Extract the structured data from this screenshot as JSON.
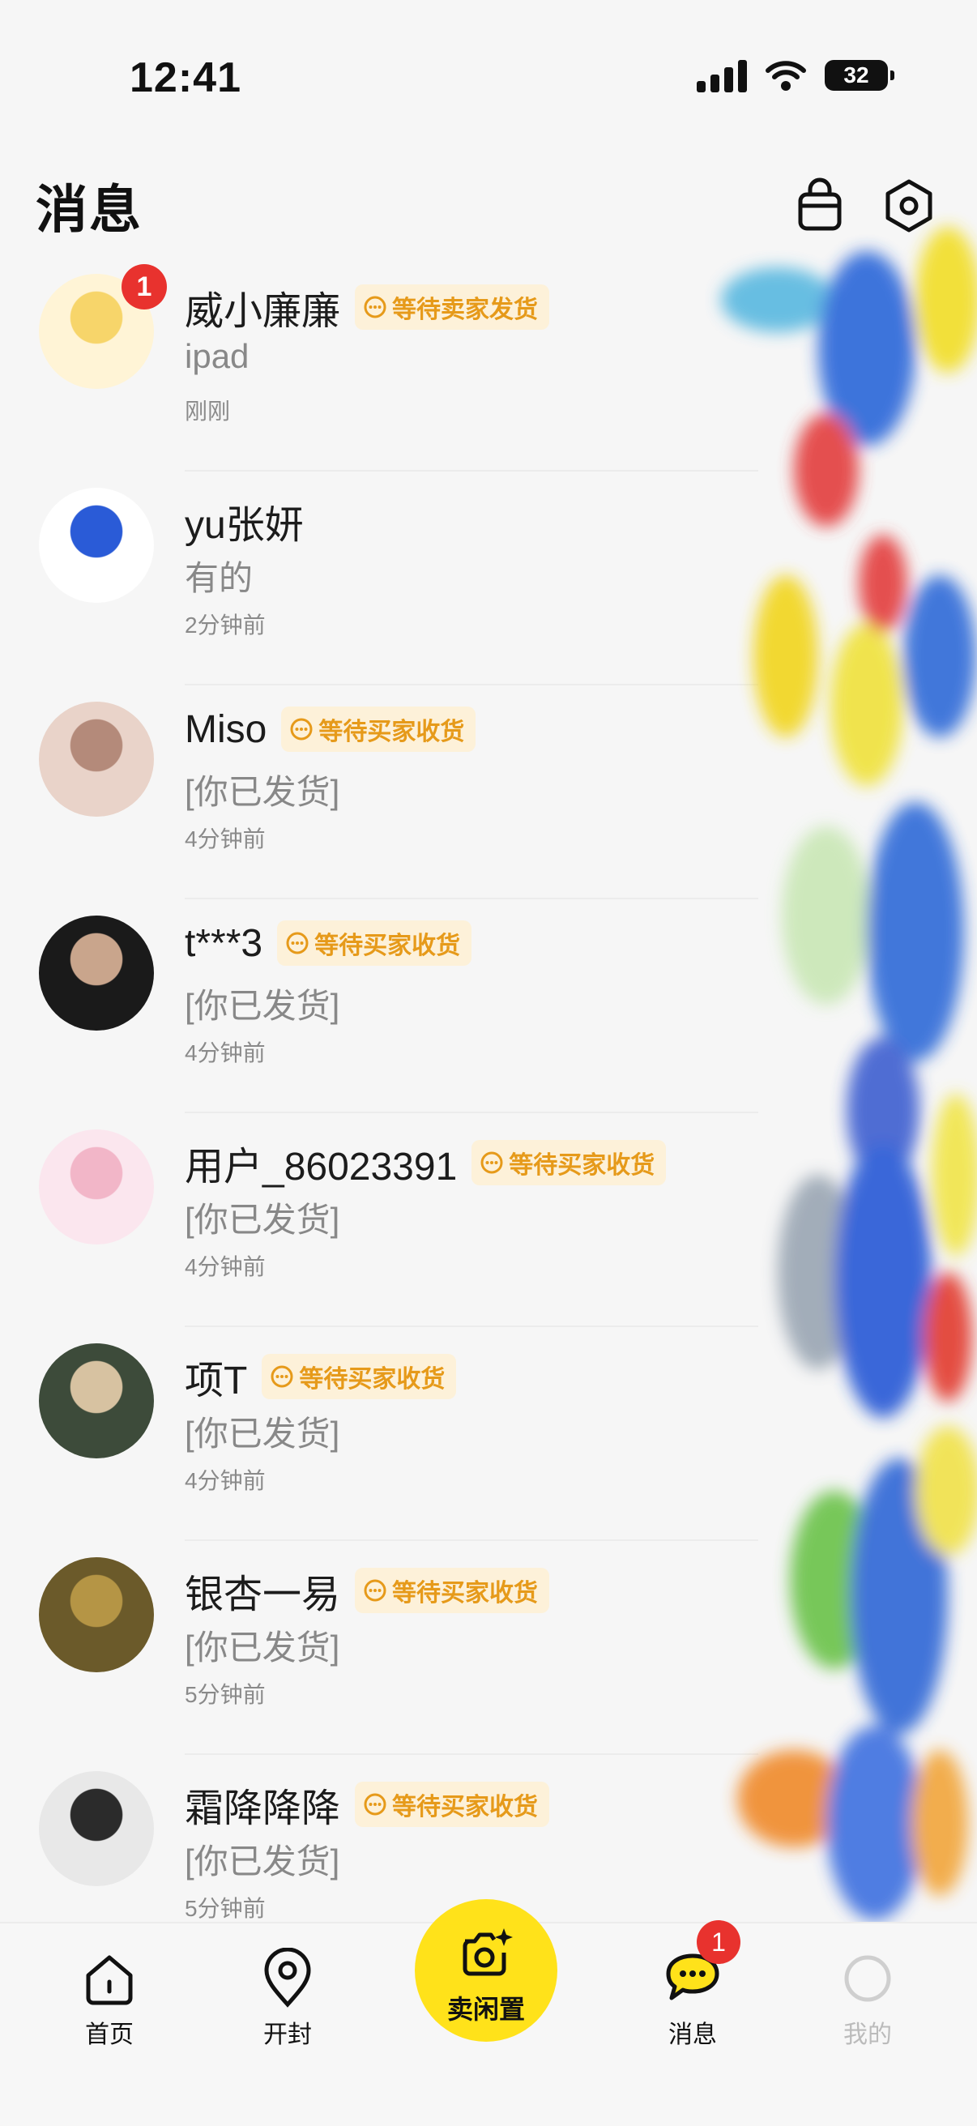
{
  "status_bar": {
    "time": "12:41",
    "battery": "32"
  },
  "header": {
    "title": "消息",
    "icons": [
      "shop-bag-icon",
      "settings-hex-icon"
    ]
  },
  "conversations": [
    {
      "name": "威小廉廉",
      "tag": "等待卖家发货",
      "preview": "ipad",
      "time": "刚刚",
      "unread": "1",
      "avatar_colors": [
        "#fff4d6",
        "#f7d56a"
      ]
    },
    {
      "name": "yu张妍",
      "tag": "",
      "preview": "有的",
      "time": "2分钟前",
      "unread": "",
      "avatar_colors": [
        "#ffffff",
        "#2a5bd7"
      ]
    },
    {
      "name": "Miso",
      "tag": "等待买家收货",
      "preview": "[你已发货]",
      "time": "4分钟前",
      "unread": "",
      "avatar_colors": [
        "#e9d3c9",
        "#b48a7a"
      ]
    },
    {
      "name": "t***3",
      "tag": "等待买家收货",
      "preview": "[你已发货]",
      "time": "4分钟前",
      "unread": "",
      "avatar_colors": [
        "#1a1a1a",
        "#c9a58c"
      ]
    },
    {
      "name": "用户_86023391",
      "tag": "等待买家收货",
      "preview": "[你已发货]",
      "time": "4分钟前",
      "unread": "",
      "avatar_colors": [
        "#fbe6ee",
        "#f2b6c8"
      ]
    },
    {
      "name": "项T",
      "tag": "等待买家收货",
      "preview": "[你已发货]",
      "time": "4分钟前",
      "unread": "",
      "avatar_colors": [
        "#3d4b3a",
        "#d7c2a1"
      ]
    },
    {
      "name": "银杏一易",
      "tag": "等待买家收货",
      "preview": "[你已发货]",
      "time": "5分钟前",
      "unread": "",
      "avatar_colors": [
        "#6b5a2a",
        "#b59545"
      ]
    },
    {
      "name": "霜降降降",
      "tag": "等待买家收货",
      "preview": "[你已发货]",
      "time": "5分钟前",
      "unread": "",
      "avatar_colors": [
        "#e8e8e8",
        "#2b2b2b"
      ]
    }
  ],
  "tabbar": {
    "home": "首页",
    "nearby": "开封",
    "sell": "卖闲置",
    "messages": "消息",
    "messages_badge": "1",
    "mine": "我的"
  },
  "colors": {
    "accent": "#ffe21a",
    "badge": "#e8322e",
    "tag_text": "#e69a1a",
    "tag_bg": "#fdf1d9"
  }
}
